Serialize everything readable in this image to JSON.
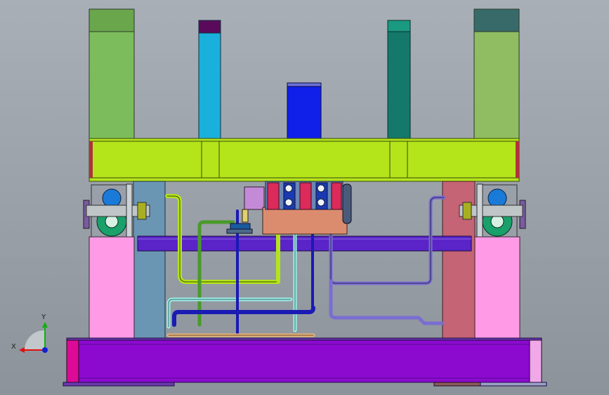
{
  "viewport": {
    "background_top": "#a9afb7",
    "background_bottom": "#8c939b"
  },
  "axis_triad": {
    "x_label": "X",
    "y_label": "Y",
    "x_color": "#e01010",
    "y_color": "#10b010",
    "z_color": "#1020d0"
  },
  "colors": {
    "pillar_left": "#7cbc5c",
    "pillar_left_cap": "#6aa64c",
    "pillar_cyan": "#1ab0dc",
    "pillar_cyan_cap": "#5a0a5a",
    "pillar_blue": "#1020e8",
    "pillar_teal": "#14786a",
    "pillar_right": "#90bc62",
    "pillar_right_cap": "#386a6a",
    "top_beam": "#b4e41a",
    "lower_beam": "#5a24c8",
    "pink_column": "#ff9ae6",
    "steel_column": "#6a96b4",
    "rose_column": "#c46474",
    "base_plate": "#8c0ad0",
    "base_end": "#dc0a96",
    "manifold": "#dc8c6e",
    "pipe_lime": "#b4e41a",
    "pipe_aqua": "#a0f0e8",
    "pipe_navy": "#1a1ab4",
    "pipe_purple": "#7a6ed0",
    "pipe_green": "#4a9a2a",
    "pipe_tan": "#e8b47a",
    "bearing_green": "#1aa06a"
  }
}
